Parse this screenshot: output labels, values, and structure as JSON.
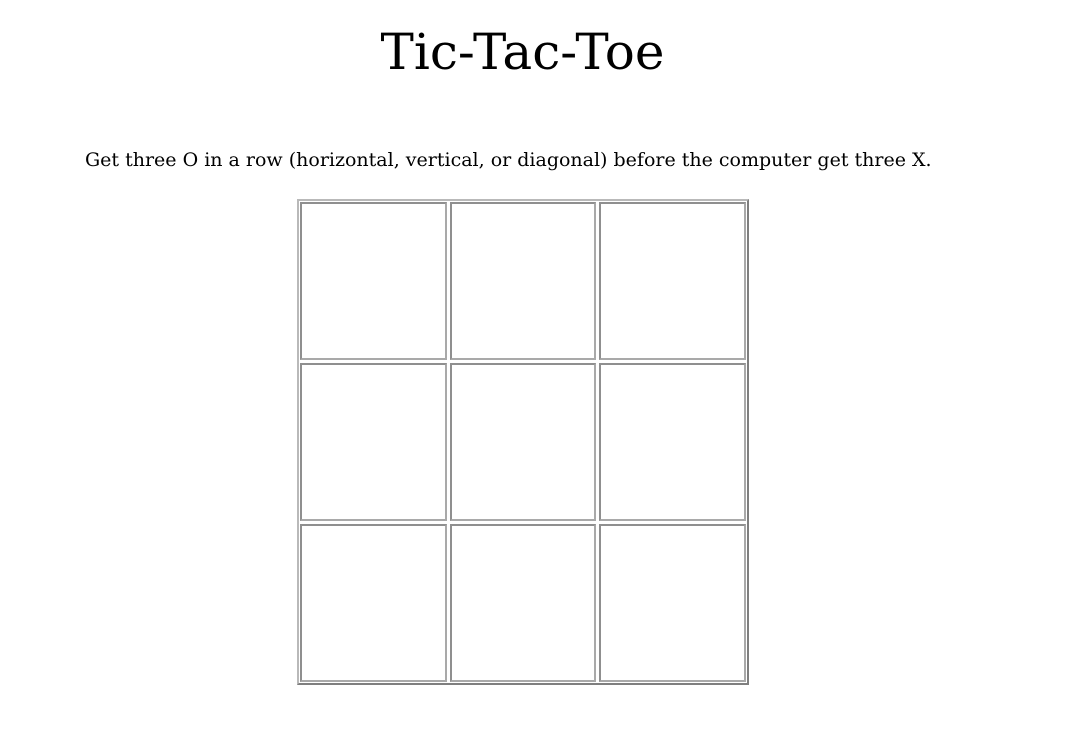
{
  "title": "Tic-Tac-Toe",
  "instructions": "Get three O in a row (horizontal, vertical, or diagonal) before the computer get three X.",
  "board": {
    "cells": [
      "",
      "",
      "",
      "",
      "",
      "",
      "",
      "",
      ""
    ]
  }
}
